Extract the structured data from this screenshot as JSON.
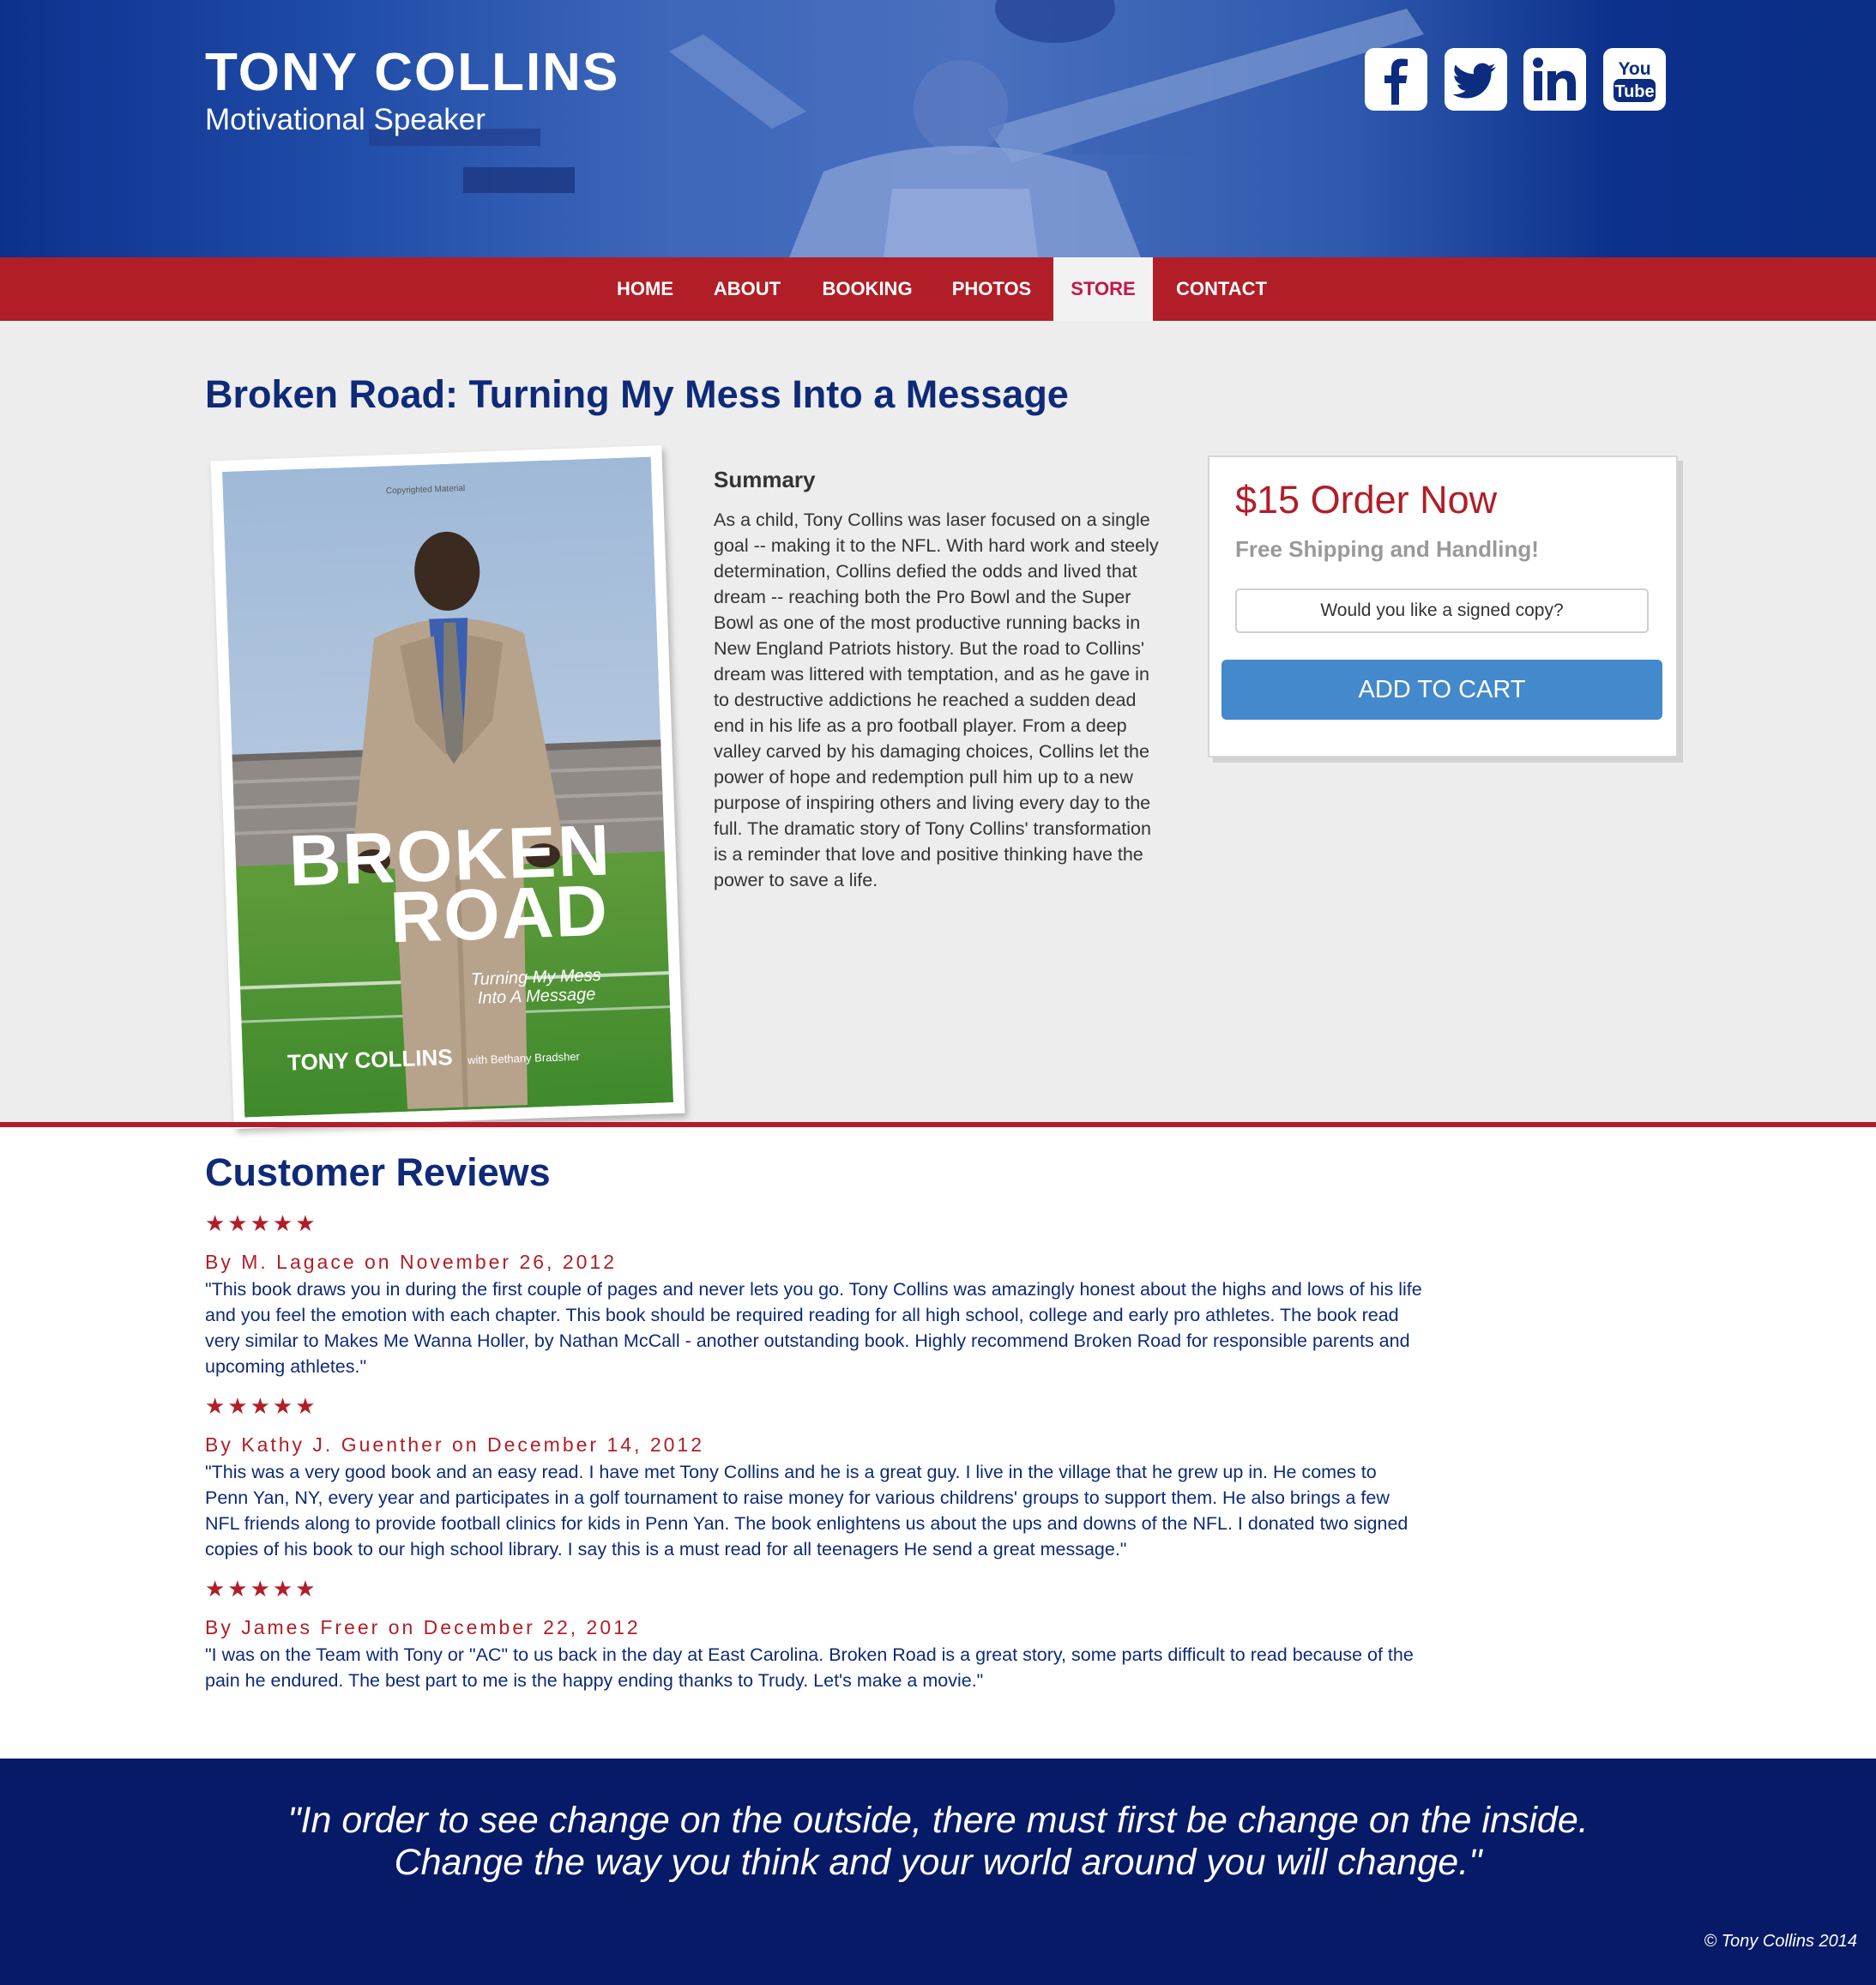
{
  "header": {
    "name": "TONY COLLINS",
    "subtitle": "Motivational Speaker",
    "social": [
      {
        "label": "f",
        "icon": "facebook-icon"
      },
      {
        "label": "twitter",
        "icon": "twitter-icon"
      },
      {
        "label": "in",
        "icon": "linkedin-icon"
      },
      {
        "label": "You Tube",
        "icon": "youtube-icon"
      }
    ]
  },
  "nav": {
    "items": [
      {
        "label": "HOME"
      },
      {
        "label": "ABOUT"
      },
      {
        "label": "BOOKING"
      },
      {
        "label": "PHOTOS"
      },
      {
        "label": "STORE",
        "active": true
      },
      {
        "label": "CONTACT"
      }
    ]
  },
  "product": {
    "title": "Broken Road: Turning My Mess Into a Message",
    "cover": {
      "copyright": "Copyrighted Material",
      "title_line1": "BROKEN",
      "title_line2": "ROAD",
      "subtitle_line1": "Turning My Mess",
      "subtitle_line2": "Into A Message",
      "author": "TONY COLLINS",
      "coauthor": "with Bethany Bradsher"
    },
    "summary_title": "Summary",
    "summary": "As a child, Tony Collins was laser focused on a single goal -- making it to the NFL. With hard work and steely determination, Collins defied the odds and lived that dream -- reaching both the Pro Bowl and the Super Bowl as one of the most productive running backs in New England Patriots history. But the road to Collins' dream was littered with temptation, and as he gave in to destructive addictions he reached a sudden dead end in his life as a pro football player. From a deep valley carved by his damaging choices, Collins let the power of hope and redemption pull him up to a new purpose of inspiring others and living every day to the full. The dramatic story of Tony Collins' transformation is a reminder that love and positive thinking have the power to save a life.",
    "order": {
      "title": "$15 Order Now",
      "subtitle": "Free Shipping and Handling!",
      "signed_option": "Would you like a signed copy?",
      "cart_label": "ADD TO CART"
    }
  },
  "reviews": {
    "title": "Customer Reviews",
    "items": [
      {
        "rating": 5,
        "stars": "★★★★★",
        "meta": "By M. Lagace on November 26, 2012",
        "text": "\"This book draws you in during the first couple of pages and never lets you go. Tony Collins was amazingly honest about the highs and lows of his life and you feel the emotion with each chapter. This book should be required reading for all high school, college and early pro athletes. The book read very similar to Makes Me Wanna Holler, by Nathan McCall - another outstanding book. Highly recommend Broken Road for responsible parents and upcoming athletes.\""
      },
      {
        "rating": 5,
        "stars": "★★★★★",
        "meta": "By Kathy J. Guenther on December 14, 2012",
        "text": "\"This was a very good book and an easy read. I have met Tony Collins and he is a great guy. I live in the village that he grew up in. He comes to Penn Yan, NY, every year and participates in a golf tournament to raise money for various childrens' groups to support them. He also brings a few NFL friends along to provide football clinics for kids in Penn Yan. The book enlightens us about the ups and downs of the NFL. I donated two signed copies of his book to our high school library. I say this is a must read for all teenagers He send a great message.\""
      },
      {
        "rating": 5,
        "stars": "★★★★★",
        "meta": "By James Freer on December 22, 2012",
        "text": "\"I was on the Team with Tony or \"AC\" to us back in the day at East Carolina. Broken Road is a great story, some parts difficult to read because of the pain he endured. The best part to me is the happy ending thanks to Trudy. Let's make a movie.\""
      }
    ]
  },
  "footer": {
    "quote_line1": "\"In order to see change on the outside, there must first be change on the inside.",
    "quote_line2": "Change the way you think and your world around you will change.\"",
    "copyright": "© Tony Collins 2014"
  },
  "colors": {
    "header_blue": "#0c318c",
    "nav_red": "#b11e27",
    "title_navy": "#0e2a78",
    "cart_blue": "#4389cb",
    "footer_navy": "#061a68",
    "active_nav_text": "#c5164a"
  }
}
